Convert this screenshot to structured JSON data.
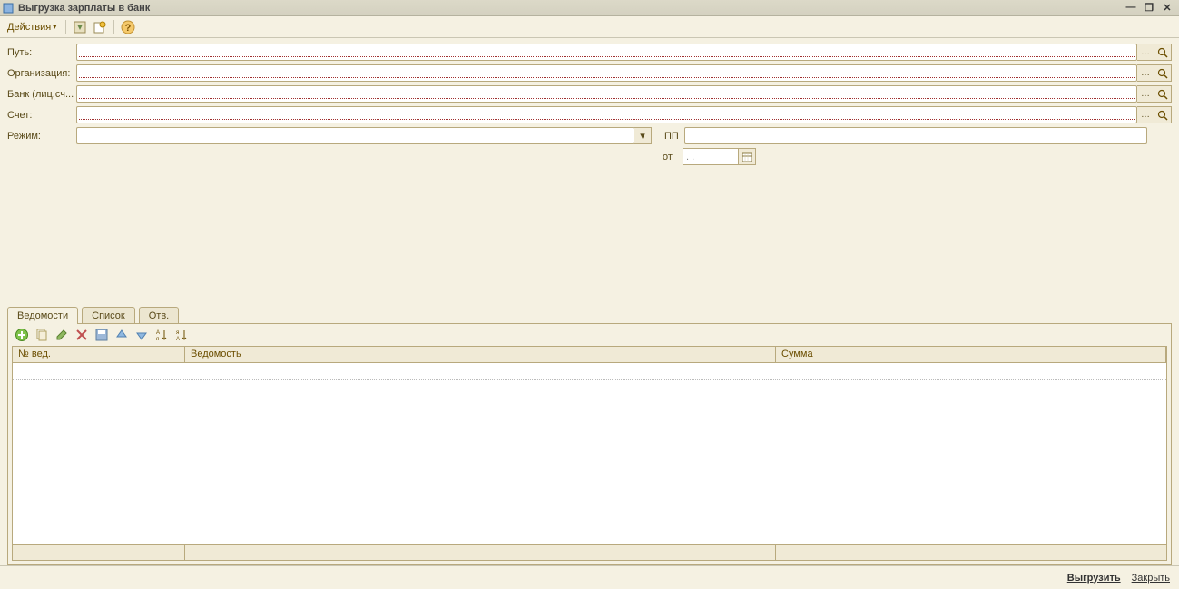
{
  "window": {
    "title": "Выгрузка зарплаты в банк"
  },
  "toolbar": {
    "actions": "Действия"
  },
  "form": {
    "path_label": "Путь:",
    "org_label": "Организация:",
    "bank_label": "Банк (лиц.сч...",
    "account_label": "Счет:",
    "mode_label": "Режим:",
    "pp_label": "ПП",
    "from_label": "от",
    "date_placeholder": " .  ."
  },
  "tabs": [
    {
      "label": "Ведомости"
    },
    {
      "label": "Список"
    },
    {
      "label": "Отв."
    }
  ],
  "grid": {
    "columns": [
      "№ вед.",
      "Ведомость",
      "Сумма"
    ]
  },
  "footer": {
    "export": "Выгрузить",
    "close": "Закрыть"
  }
}
